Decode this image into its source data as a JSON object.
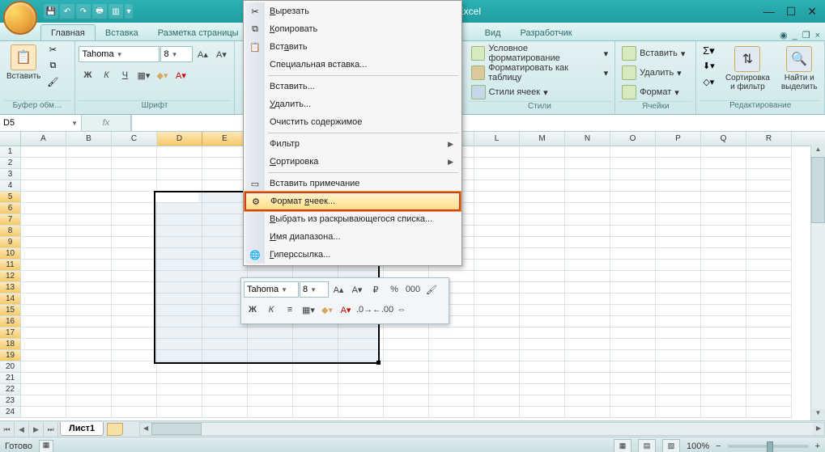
{
  "app_title": "Microsoft Excel",
  "qat_icons": [
    "save",
    "undo",
    "redo",
    "print",
    "preview"
  ],
  "tabs": {
    "items": [
      "Главная",
      "Вставка",
      "Разметка страницы",
      "",
      "",
      "Вид",
      "Разработчик"
    ],
    "active": 0
  },
  "ribbon": {
    "clipboard": {
      "paste": "Вставить",
      "label": "Буфер обм…"
    },
    "font": {
      "name": "Tahoma",
      "size": "8",
      "label": "Шрифт",
      "bold": "Ж",
      "italic": "К",
      "underline": "Ч"
    },
    "styles": {
      "label": "Стили",
      "cond": "Условное форматирование",
      "table": "Форматировать как таблицу",
      "cell": "Стили ячеек"
    },
    "cells": {
      "label": "Ячейки",
      "insert": "Вставить",
      "delete": "Удалить",
      "format": "Формат"
    },
    "editing": {
      "label": "Редактирование",
      "sort": "Сортировка и фильтр",
      "find": "Найти и выделить"
    }
  },
  "namebox": "D5",
  "columns": [
    "A",
    "B",
    "C",
    "D",
    "E",
    "",
    "",
    "",
    "",
    "K",
    "L",
    "M",
    "N",
    "O",
    "P",
    "Q",
    "R"
  ],
  "rowcount": 24,
  "sel_cols_idx": [
    3,
    4,
    5,
    6,
    7
  ],
  "sel_rows_idx": [
    5,
    6,
    7,
    8,
    9,
    10,
    11,
    12,
    13,
    14,
    15,
    16,
    17,
    18,
    19
  ],
  "context_menu": [
    {
      "icon": "✂",
      "label": "Вырезать",
      "u": 0
    },
    {
      "icon": "⧉",
      "label": "Копировать",
      "u": 0
    },
    {
      "icon": "📋",
      "label": "Вставить",
      "u": 3
    },
    {
      "label": "Специальная вставка...",
      "u": -1
    },
    {
      "sep": true
    },
    {
      "label": "Вставить...",
      "u": -1
    },
    {
      "label": "Удалить...",
      "u": 0
    },
    {
      "label": "Очистить содержимое",
      "u": -1
    },
    {
      "sep": true
    },
    {
      "label": "Фильтр",
      "u": -1,
      "sub": true
    },
    {
      "label": "Сортировка",
      "u": 0,
      "sub": true
    },
    {
      "sep": true
    },
    {
      "icon": "▭",
      "label": "Вставить примечание",
      "u": -1
    },
    {
      "icon": "⚙",
      "label": "Формат ячеек...",
      "u": 7,
      "hl": true
    },
    {
      "label": "Выбрать из раскрывающегося списка...",
      "u": 0
    },
    {
      "label": "Имя диапазона...",
      "u": 0
    },
    {
      "icon": "🌐",
      "label": "Гиперссылка...",
      "u": 0
    }
  ],
  "mini_toolbar": {
    "font": "Tahoma",
    "size": "8"
  },
  "sheet": {
    "name": "Лист1"
  },
  "status": {
    "ready": "Готово",
    "zoom": "100%"
  }
}
